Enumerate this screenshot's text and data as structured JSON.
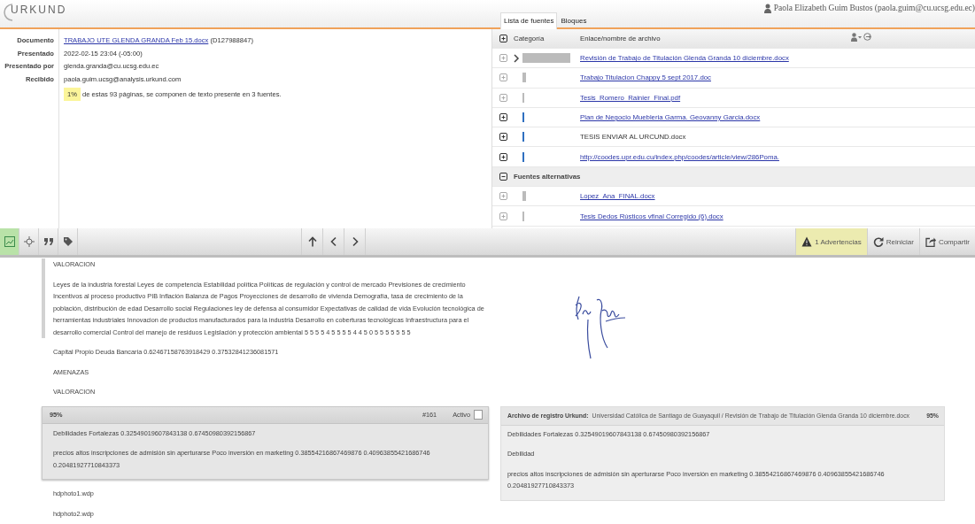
{
  "app": {
    "logo": "URKUND"
  },
  "user": {
    "name": "Paola Elizabeth Guim Bustos (paola.guim@cu.ucsg.edu.ec)"
  },
  "details": [
    {
      "label": "Documento",
      "value": "TRABAJO UTE GLENDA GRANDA Feb 15.docx",
      "note": "(D127988847)",
      "kind": "link"
    },
    {
      "label": "Presentado",
      "value": "2022-02-15 23:04 (-05:00)",
      "kind": "text"
    },
    {
      "label": "Presentado por",
      "value": "glenda.granda@cu.ucsg.edu.ec",
      "kind": "text"
    },
    {
      "label": "Recibido",
      "value": "paola.guim.ucsg@analysis.urkund.com",
      "kind": "text"
    }
  ],
  "summary": {
    "percent": "1%",
    "text": "de estas 93 páginas, se componen de texto presente en 3 fuentes."
  },
  "tabs": [
    {
      "label": "Lista de fuentes",
      "selected": true
    },
    {
      "label": "Bloques",
      "selected": false
    }
  ],
  "sources": {
    "columns": [
      "Categoría",
      "Enlace/nombre de archivo"
    ],
    "rows": [
      {
        "name": "Revisión de Trabajo de Titulación Glenda Granda 10 diciembre.docx",
        "link": true,
        "active": false,
        "selected": true,
        "kind": "wide"
      },
      {
        "name": "Trabajo Titulacion Chappy 5 sept 2017.doc",
        "link": true,
        "active": false,
        "selected": false,
        "kind": "thick"
      },
      {
        "name": "Tesis_Romero_Rainier_Final.pdf",
        "link": true,
        "active": false,
        "selected": false,
        "kind": "thin"
      },
      {
        "name": "Plan de Negocio Muebleria Garma. Geovanny Garcia.docx",
        "link": true,
        "active": true,
        "selected": false,
        "kind": "thin"
      },
      {
        "name": "TESIS ENVIAR AL URCUND.docx",
        "link": false,
        "active": true,
        "selected": false,
        "kind": "thin"
      },
      {
        "name": "http://coodes.upr.edu.cu/index.php/coodes/article/view/286Poma.",
        "link": true,
        "active": true,
        "selected": false,
        "kind": "thin"
      }
    ],
    "alternatives": {
      "title": "Fuentes alternativas",
      "expanded": true,
      "rows": [
        {
          "name": "Lopez_Ana_FINAL.docx",
          "link": true,
          "active": false,
          "selected": false,
          "kind": "thick"
        },
        {
          "name": "Tesis Dedos Rústicos vfinal Corregido (6).docx",
          "link": true,
          "active": false,
          "selected": false,
          "kind": "thin"
        }
      ]
    }
  },
  "toolbar": {
    "tools": [
      {
        "kind": "chart",
        "selected": true
      },
      {
        "kind": "target",
        "selected": false
      },
      {
        "kind": "quote",
        "selected": false
      },
      {
        "kind": "tag",
        "selected": false
      }
    ],
    "navigation": [
      {
        "kind": "up"
      },
      {
        "kind": "previous"
      },
      {
        "kind": "next"
      }
    ],
    "actions": [
      {
        "kind": "warning",
        "label": "1 Advertencias"
      },
      {
        "kind": "restart",
        "label": "Reiniciar"
      },
      {
        "kind": "share",
        "label": "Compartir"
      }
    ]
  },
  "document": {
    "blocks": [
      {
        "kind": "quoted",
        "paragraphs": [
          "VALORACION",
          "Leyes de la industria forestal Leyes de competencia Estabilidad política Políticas de regulación y control de mercado Previsiones de crecimiento Incentivos al proceso productivo PIB Inflación Balanza de Pagos Proyecciones de desarrollo de vivienda Demografía, tasa de crecimiento de la población, distribución de edad Desarrollo social Regulaciones ley de defensa al consumidor Expectativas de calidad de vida Evolución tecnológica de herramientas industriales Innovacion de productos manufacturados para la industria Desarrollo en coberturas tecnológicas Infraestructura para el desarrollo comercial Control del manejo de residuos Legislación y protección ambiental 5 5 5 5 4 5 5 5 5 4 4 5 0 5 5 5 5 5 5 5"
        ]
      },
      {
        "kind": "text",
        "text": "Capital Propio Deuda Bancaria 0.62467158763918429 0.37532841236081571"
      },
      {
        "kind": "text",
        "text": "AMENAZAS"
      },
      {
        "kind": "text",
        "text": "VALORACION"
      },
      {
        "kind": "match",
        "percent": "95%",
        "number": "#161",
        "active_label": "Activo",
        "checked": false,
        "paragraphs": [
          "Debilidades Fortalezas 0.32549019607843138 0.67450980392156867",
          "precios altos inscripciones de admisión sin aperturarse Poco inversión en marketing 0.38554216867469876 0.40963855421686746 0.20481927710843373"
        ]
      },
      {
        "kind": "text",
        "text": "hdphoto1.wdp"
      },
      {
        "kind": "text",
        "text": "hdphoto2.wdp"
      }
    ],
    "comparison": {
      "label": "Archivo de registro Urkund:",
      "source": "Universidad Católica de Santiago de Guayaquil / Revisión de Trabajo de Titulación Glenda Granda 10 diciembre.docx",
      "percent": "95%",
      "paragraphs": [
        "Debilidades Fortalezas 0.32549019607843138 0.67450980392156867",
        "Debilidad",
        "precios altos inscripciones de admisión sin aperturarse Poco inversión en marketing 0.38554216867469876 0.40963855421686746 0.20481927710843373"
      ]
    }
  }
}
